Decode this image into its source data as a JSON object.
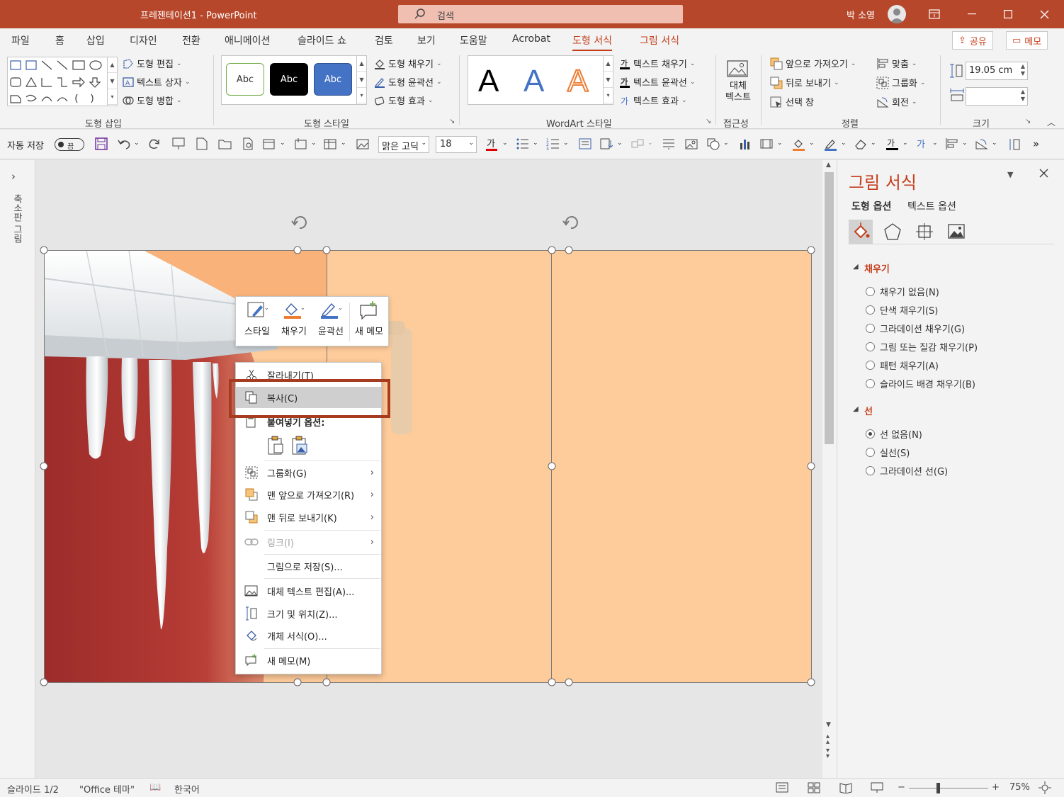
{
  "titlebar": {
    "doc_title": "프레젠테이션1  -  PowerPoint",
    "search_placeholder": "검색",
    "user_name": "박 소영"
  },
  "tabs": [
    {
      "label": "파일"
    },
    {
      "label": "홈"
    },
    {
      "label": "삽입"
    },
    {
      "label": "디자인"
    },
    {
      "label": "전환"
    },
    {
      "label": "애니메이션"
    },
    {
      "label": "슬라이드 쇼"
    },
    {
      "label": "검토"
    },
    {
      "label": "보기"
    },
    {
      "label": "도움말"
    },
    {
      "label": "Acrobat"
    },
    {
      "label": "도형 서식"
    },
    {
      "label": "그림 서식"
    }
  ],
  "share_label": "공유",
  "comment_label": "메모",
  "ribbon": {
    "insert_shapes": {
      "edit_shape": "도형 편집",
      "text_box": "텍스트 상자",
      "merge_shapes": "도형 병합",
      "label": "도형 삽입"
    },
    "shape_styles": {
      "sample": "Abc",
      "fill": "도형 채우기",
      "outline": "도형 윤곽선",
      "effects": "도형 효과",
      "label": "도형 스타일"
    },
    "wordart": {
      "letter": "A",
      "text_fill": "텍스트 채우기",
      "text_outline": "텍스트 윤곽선",
      "text_effects": "텍스트 효과",
      "label": "WordArt 스타일"
    },
    "accessibility": {
      "alt_text_line1": "대체",
      "alt_text_line2": "텍스트",
      "label": "접근성"
    },
    "arrange": {
      "bring_forward": "앞으로 가져오기",
      "send_backward": "뒤로 보내기",
      "selection_pane": "선택 창",
      "align": "맞춤",
      "group": "그룹화",
      "rotate": "회전",
      "label": "정렬"
    },
    "size": {
      "height": "19.05 cm",
      "width": "",
      "label": "크기"
    }
  },
  "qat": {
    "autosave_label": "자동 저장",
    "autosave_state": "끔",
    "font_name": "맑은 고딕",
    "font_size": "18"
  },
  "left_pane": {
    "label": "축소판 그림"
  },
  "mini_toolbar": [
    {
      "label": "스타일"
    },
    {
      "label": "채우기"
    },
    {
      "label": "윤곽선"
    },
    {
      "label": "새 메모"
    }
  ],
  "context_menu": {
    "cut": "잘라내기(T)",
    "copy": "복사(C)",
    "paste_options": "붙여넣기 옵션:",
    "group": "그룹화(G)",
    "bring_to_front": "맨 앞으로 가져오기(R)",
    "send_to_back": "맨 뒤로 보내기(K)",
    "link": "링크(I)",
    "save_as_picture": "그림으로 저장(S)...",
    "edit_alt_text": "대체 텍스트 편집(A)...",
    "size_position": "크기 및 위치(Z)...",
    "format_object": "개체 서식(O)...",
    "new_comment": "새 메모(M)"
  },
  "format_pane": {
    "title": "그림 서식",
    "tab_shape": "도형 옵션",
    "tab_text": "텍스트 옵션",
    "fill_section": "채우기",
    "fill_options": [
      {
        "label": "채우기 없음(N)",
        "selected": false
      },
      {
        "label": "단색 채우기(S)",
        "selected": false
      },
      {
        "label": "그라데이션 채우기(G)",
        "selected": false
      },
      {
        "label": "그림 또는 질감 채우기(P)",
        "selected": false
      },
      {
        "label": "패턴 채우기(A)",
        "selected": false
      },
      {
        "label": "슬라이드 배경 채우기(B)",
        "selected": false
      }
    ],
    "line_section": "선",
    "line_options": [
      {
        "label": "선 없음(N)",
        "selected": true
      },
      {
        "label": "실선(S)",
        "selected": false
      },
      {
        "label": "그라데이션 선(G)",
        "selected": false
      }
    ]
  },
  "status": {
    "slide_info": "슬라이드 1/2",
    "theme": "\"Office 테마\"",
    "language": "한국어",
    "zoom": "75%"
  },
  "colors": {
    "accent": "#b7472a",
    "slide_bg": "#fecb9a",
    "highlight_box": "#a63b20"
  }
}
